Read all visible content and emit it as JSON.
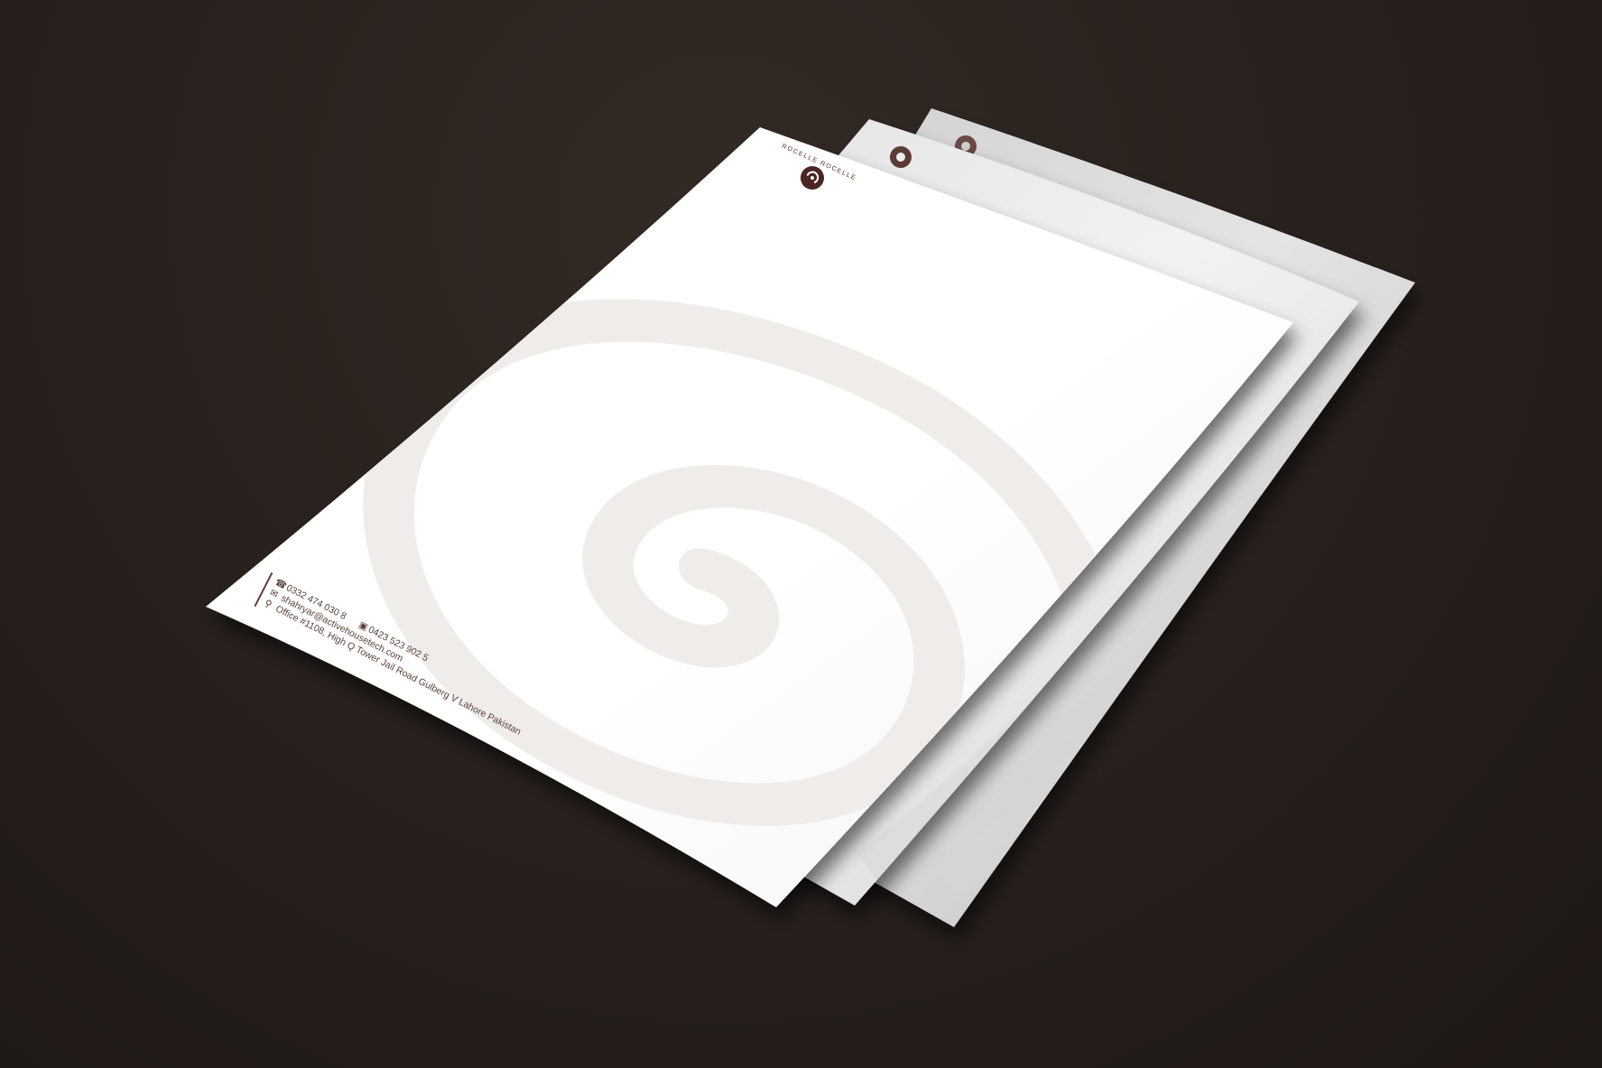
{
  "brand": {
    "name": "ROCELLE ROCELLE",
    "accent_color": "#5a2b24",
    "swirl_color": "#efecea"
  },
  "letterhead": {
    "phone": "0332 474 030 8",
    "fax": "0423 523 902 5",
    "email": "shahryar@activehousetech.com",
    "address": "Office #1108, High Q Tower Jail Road Gulberg V Lahore Pakistan",
    "icons": {
      "phone": "phone-icon",
      "fax": "fax-icon",
      "email": "email-icon",
      "address": "location-pin-icon"
    }
  },
  "background_color": "#231c19"
}
